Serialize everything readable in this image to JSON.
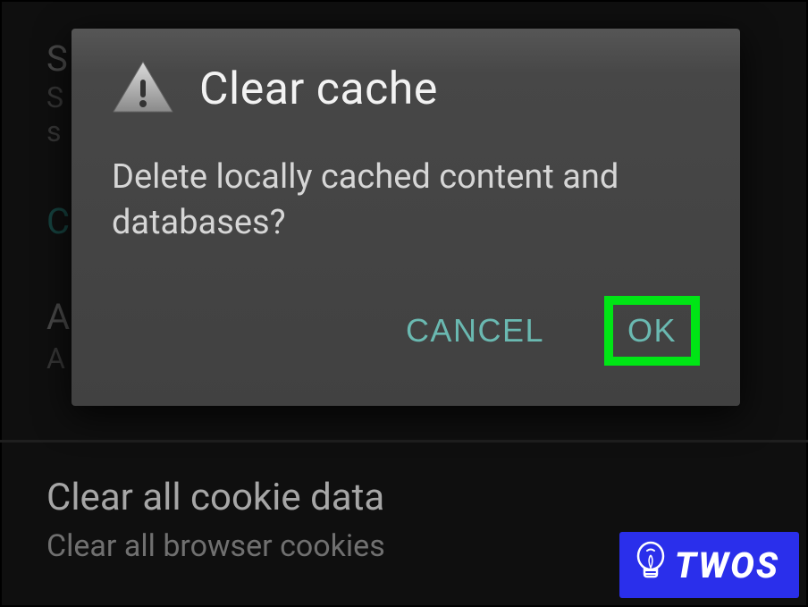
{
  "background": {
    "section1": {
      "line1": "S",
      "line2": "S",
      "line3": "s"
    },
    "section2": {
      "line1": "C"
    },
    "section3": {
      "line1": "A",
      "line2": "A"
    },
    "bottom": {
      "title": "Clear all cookie data",
      "subtitle": "Clear all browser cookies"
    }
  },
  "dialog": {
    "title": "Clear cache",
    "message": "Delete locally cached content and databases?",
    "cancel_label": "CANCEL",
    "ok_label": "OK"
  },
  "badge": {
    "text": "TWOS"
  }
}
